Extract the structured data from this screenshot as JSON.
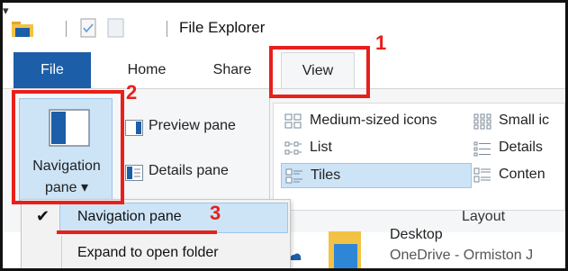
{
  "window": {
    "title": "File Explorer",
    "quick_access_dropdown": "▾"
  },
  "tabs": {
    "file": "File",
    "home": "Home",
    "share": "Share",
    "view": "View"
  },
  "panes": {
    "navigation_pane_line1": "Navigation",
    "navigation_pane_line2": "pane ▾",
    "preview_pane": "Preview pane",
    "details_pane": "Details pane"
  },
  "layout": {
    "group_label": "Layout",
    "items": {
      "medium_icons": "Medium-sized icons",
      "small_icons": "Small ic",
      "list": "List",
      "details": "Details",
      "tiles": "Tiles",
      "content": "Conten"
    },
    "selected": "Tiles"
  },
  "dropdown": {
    "check": "✔",
    "navigation_pane": "Navigation pane",
    "expand_to_open_folder": "Expand to open folder"
  },
  "content": {
    "desktop": "Desktop",
    "onedrive": "OneDrive - Ormiston J"
  },
  "annotations": {
    "step1": "1",
    "step2": "2",
    "step3": "3",
    "color": "#e8201a"
  },
  "colors": {
    "file_tab": "#1c5ea8",
    "selection": "#cde4f7"
  }
}
